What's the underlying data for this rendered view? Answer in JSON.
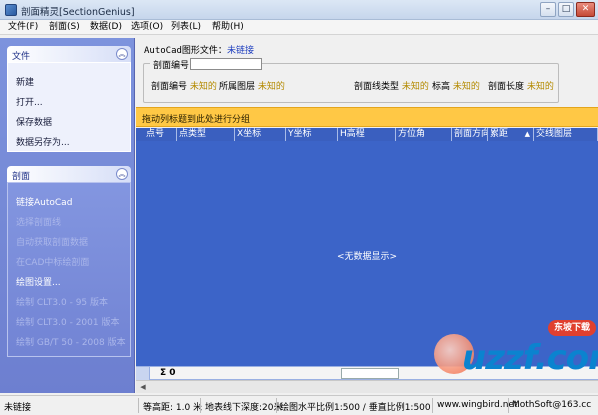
{
  "window": {
    "title": "剖面精灵[SectionGenius]",
    "min_glyph": "–",
    "max_glyph": "□",
    "close_glyph": "✕"
  },
  "menu": [
    "文件(F)",
    "剖面(S)",
    "数据(D)",
    "选项(O)",
    "列表(L)",
    "帮助(H)"
  ],
  "sidebar": {
    "file_panel": {
      "title": "文件",
      "items": [
        "新建",
        "打开...",
        "保存数据",
        "数据另存为..."
      ]
    },
    "section_panel": {
      "title": "剖面",
      "items": [
        "链接AutoCad",
        "选择剖面线",
        "自动获取剖面数据",
        "在CAD中标绘剖面",
        "绘图设置...",
        "绘制 CLT3.0 - 95 版本",
        "绘制 CLT3.0 - 2001 版本",
        "绘制 GB/T 50 - 2008 版本"
      ]
    },
    "collapse_glyph": "︽"
  },
  "autocad": {
    "label": "AutoCad图形文件：",
    "status": "未链接"
  },
  "section_group": {
    "title": "剖面编号",
    "fields": [
      {
        "label": "剖面编号",
        "value": "未知的"
      },
      {
        "label": "所属图层",
        "value": "未知的"
      },
      {
        "label": "剖面线类型",
        "value": "未知的"
      },
      {
        "label": "标高",
        "value": "未知的"
      },
      {
        "label": "剖面长度",
        "value": "未知的"
      }
    ]
  },
  "grid": {
    "group_hint": "拖动列标题到此处进行分组",
    "columns": [
      "点号",
      "点类型",
      "X坐标",
      "Y坐标",
      "H高程",
      "方位角",
      "剖面方向",
      "累距",
      "交线图层"
    ],
    "sort_glyph": "▲",
    "empty_text": "<无数据显示>",
    "summary": "Σ 0"
  },
  "statusbar": {
    "link_status": "未链接",
    "contour": "等高距: 1.0 米",
    "depth": "地表线下深度:20米",
    "scale": "绘图水平比例1:500 / 垂直比例1:500",
    "site": "www.wingbird.net",
    "email": "MothSoft@163.cc"
  },
  "watermark": {
    "badge": "东坡下载",
    "logo": "uzzf.com"
  }
}
